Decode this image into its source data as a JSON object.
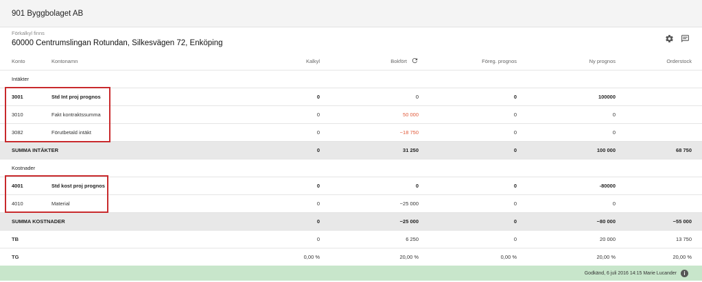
{
  "company": "901 Byggbolaget AB",
  "subtitle": "Förkalkyl finns",
  "project": "60000 Centrumslingan Rotundan, Silkesvägen 72, Enköping",
  "columns": {
    "konto": "Konto",
    "kontonamn": "Kontonamn",
    "kalkyl": "Kalkyl",
    "bokfort": "Bokfört",
    "foreg": "Föreg. prognos",
    "ny": "Ny prognos",
    "orderstock": "Orderstock"
  },
  "sections": {
    "intakter": "Intäkter",
    "kostnader": "Kostnader"
  },
  "rows": {
    "r3001": {
      "konto": "3001",
      "namn": "Std Int proj prognos",
      "kalkyl": "0",
      "bokfort": "0",
      "foreg": "0",
      "ny": "100000",
      "order": ""
    },
    "r3010": {
      "konto": "3010",
      "namn": "Fakt kontraktssumma",
      "kalkyl": "0",
      "bokfort": "50 000",
      "foreg": "0",
      "ny": "0",
      "order": ""
    },
    "r3082": {
      "konto": "3082",
      "namn": "Förutbetald intäkt",
      "kalkyl": "0",
      "bokfort": "−18 750",
      "foreg": "0",
      "ny": "0",
      "order": ""
    },
    "summaIntakter": {
      "label": "SUMMA INTÄKTER",
      "kalkyl": "0",
      "bokfort": "31 250",
      "foreg": "0",
      "ny": "100 000",
      "order": "68 750"
    },
    "r4001": {
      "konto": "4001",
      "namn": "Std kost proj prognos",
      "kalkyl": "0",
      "bokfort": "0",
      "foreg": "0",
      "ny": "-80000",
      "order": ""
    },
    "r4010": {
      "konto": "4010",
      "namn": "Material",
      "kalkyl": "0",
      "bokfort": "−25 000",
      "foreg": "0",
      "ny": "0",
      "order": ""
    },
    "summaKostnader": {
      "label": "SUMMA KOSTNADER",
      "kalkyl": "0",
      "bokfort": "−25 000",
      "foreg": "0",
      "ny": "−80 000",
      "order": "−55 000"
    },
    "tb": {
      "label": "TB",
      "kalkyl": "0",
      "bokfort": "6 250",
      "foreg": "0",
      "ny": "20 000",
      "order": "13 750"
    },
    "tg": {
      "label": "TG",
      "kalkyl": "0,00 %",
      "bokfort": "20,00 %",
      "foreg": "0,00 %",
      "ny": "20,00 %",
      "order": "20,00 %"
    }
  },
  "footer": {
    "status": "Godkänd, 6 juli 2016 14:15 Marie Lucander"
  },
  "icons": {
    "settings": "gear-icon",
    "comment": "comment-icon",
    "refresh": "refresh-icon",
    "info": "info-icon"
  },
  "colors": {
    "negative": "#e15a3a",
    "footer": "#c8e6cb",
    "highlight": "#c8282b"
  }
}
